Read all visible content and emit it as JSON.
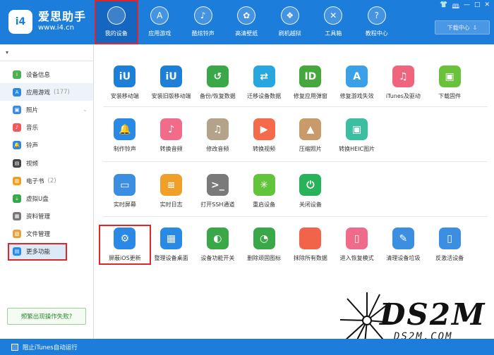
{
  "app": {
    "name": "爱思助手",
    "url": "www.i4.cn",
    "logo_text": "i4"
  },
  "nav": [
    {
      "label": "我的设备",
      "icon": "apple-icon",
      "glyph": "",
      "active": true
    },
    {
      "label": "应用游戏",
      "icon": "appstore-icon",
      "glyph": "A"
    },
    {
      "label": "酷炫铃声",
      "icon": "bell-icon",
      "glyph": "♪"
    },
    {
      "label": "高清壁纸",
      "icon": "flower-icon",
      "glyph": "✿"
    },
    {
      "label": "刷机越狱",
      "icon": "box-icon",
      "glyph": "❖"
    },
    {
      "label": "工具箱",
      "icon": "tools-icon",
      "glyph": "✕"
    },
    {
      "label": "教程中心",
      "icon": "tutorial-icon",
      "glyph": "?"
    }
  ],
  "header": {
    "download_label": "下载中心",
    "controls": [
      "👕",
      "🕮",
      "—",
      "□",
      "✕"
    ]
  },
  "sidebar": {
    "device_arrow": "▾",
    "items": [
      {
        "label": "设备信息",
        "icon": "info-icon",
        "color": "#4caf50",
        "glyph": "i"
      },
      {
        "label": "应用游戏",
        "count": "(177)",
        "icon": "app-icon",
        "color": "#2b89e6",
        "glyph": "A"
      },
      {
        "label": "照片",
        "icon": "photo-icon",
        "color": "#3d8be0",
        "glyph": "▣"
      },
      {
        "label": "音乐",
        "icon": "music-icon",
        "color": "#f05a5a",
        "glyph": "♪"
      },
      {
        "label": "铃声",
        "icon": "bell-icon",
        "color": "#2b89e6",
        "glyph": "🔔"
      },
      {
        "label": "视频",
        "icon": "video-icon",
        "color": "#444",
        "glyph": "▤"
      },
      {
        "label": "电子书",
        "count": "(2)",
        "icon": "book-icon",
        "color": "#f0a020",
        "glyph": "▥"
      },
      {
        "label": "虚拟U盘",
        "icon": "usb-icon",
        "color": "#3aa848",
        "glyph": "⇣"
      },
      {
        "label": "资料管理",
        "icon": "contacts-icon",
        "color": "#777",
        "glyph": "▦"
      },
      {
        "label": "文件管理",
        "icon": "file-icon",
        "color": "#e6a23c",
        "glyph": "▧"
      },
      {
        "label": "更多功能",
        "icon": "more-icon",
        "color": "#2b89e6",
        "glyph": "▤"
      }
    ],
    "help_label": "频繁出现操作失败?"
  },
  "tools": {
    "row1": [
      {
        "label": "安装移动端",
        "icon": "i4-install-icon",
        "color": "#1e7fd8",
        "glyph": "iU"
      },
      {
        "label": "安装旧版移动端",
        "icon": "i4-old-icon",
        "color": "#1e7fd8",
        "glyph": "iU"
      },
      {
        "label": "备份/恢复数据",
        "icon": "backup-icon",
        "color": "#3aa848",
        "glyph": "↺"
      },
      {
        "label": "迁移设备数据",
        "icon": "migrate-icon",
        "color": "#27a6e0",
        "glyph": "⇄"
      },
      {
        "label": "修复应用弹窗",
        "icon": "appleid-icon",
        "color": "#44a83c",
        "glyph": "ID"
      },
      {
        "label": "修复游戏失效",
        "icon": "appstore-fix-icon",
        "color": "#3aa0e8",
        "glyph": "A"
      },
      {
        "label": "iTunes及驱动",
        "icon": "itunes-icon",
        "color": "#f0647e",
        "glyph": "♫"
      },
      {
        "label": "下载固件",
        "icon": "firmware-icon",
        "color": "#6ac23a",
        "glyph": "▣"
      }
    ],
    "row2": [
      {
        "label": "制作铃声",
        "icon": "ringtone-icon",
        "color": "#2b89e6",
        "glyph": "🔔"
      },
      {
        "label": "转换音频",
        "icon": "audio-icon",
        "color": "#f26c8a",
        "glyph": "♪"
      },
      {
        "label": "修改音频",
        "icon": "edit-audio-icon",
        "color": "#b4a28a",
        "glyph": "♫"
      },
      {
        "label": "转换视频",
        "icon": "video-convert-icon",
        "color": "#f56a4a",
        "glyph": "▶"
      },
      {
        "label": "压缩照片",
        "icon": "compress-photo-icon",
        "color": "#c99a6a",
        "glyph": "▲"
      },
      {
        "label": "转换HEIC图片",
        "icon": "heic-icon",
        "color": "#3cbfa0",
        "glyph": "▣"
      }
    ],
    "row3": [
      {
        "label": "实时屏幕",
        "icon": "screen-icon",
        "color": "#3c8ee0",
        "glyph": "▭"
      },
      {
        "label": "实时日志",
        "icon": "log-icon",
        "color": "#f0a028",
        "glyph": "≡"
      },
      {
        "label": "打开SSH通道",
        "icon": "ssh-icon",
        "color": "#7a7a7a",
        "glyph": ">_"
      },
      {
        "label": "重启设备",
        "icon": "restart-icon",
        "color": "#62c43a",
        "glyph": "✳"
      },
      {
        "label": "关闭设备",
        "icon": "power-icon",
        "color": "#28b35a",
        "glyph": "⏻"
      }
    ],
    "row4": [
      {
        "label": "屏蔽iOS更新",
        "icon": "block-update-icon",
        "color": "#2b89e6",
        "glyph": "⚙",
        "boxed": true
      },
      {
        "label": "整理设备桌面",
        "icon": "desktop-icon",
        "color": "#2b89e6",
        "glyph": "▦"
      },
      {
        "label": "设备功能开关",
        "icon": "switch-icon",
        "color": "#3aa848",
        "glyph": "◐"
      },
      {
        "label": "删除顽固图标",
        "icon": "delete-icon",
        "color": "#3aa848",
        "glyph": "◔"
      },
      {
        "label": "抹除所有数据",
        "icon": "erase-icon",
        "color": "#f2644a",
        "glyph": ""
      },
      {
        "label": "进入恢复模式",
        "icon": "recovery-icon",
        "color": "#f06a8a",
        "glyph": "▯"
      },
      {
        "label": "清理设备垃圾",
        "icon": "clean-icon",
        "color": "#3c8ee0",
        "glyph": "✎"
      },
      {
        "label": "反激活设备",
        "icon": "deactivate-icon",
        "color": "#3c8ee0",
        "glyph": "▯"
      }
    ]
  },
  "bottom": {
    "itunes_label": "阻止iTunes自动运行"
  },
  "watermark": {
    "big": "DS2M",
    "small": "DS2M.COM"
  }
}
